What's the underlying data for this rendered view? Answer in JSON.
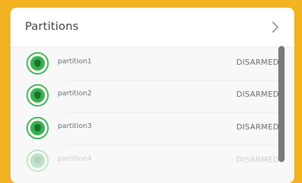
{
  "card": {
    "title": "Partitions",
    "header_icon": "chevron-right-icon"
  },
  "partitions": [
    {
      "name": "partition1",
      "status": "DISARMED",
      "icon": "shield-icon"
    },
    {
      "name": "partition2",
      "status": "DISARMED",
      "icon": "shield-icon"
    },
    {
      "name": "partition3",
      "status": "DISARMED",
      "icon": "shield-icon"
    },
    {
      "name": "partition4",
      "status": "DISARMED",
      "icon": "shield-icon"
    }
  ],
  "colors": {
    "frame": "#f4b323",
    "badge_ring": "#37b24d",
    "badge_fill": "#37b24d",
    "text": "#6a6a6a",
    "scrollbar": "#7a7a7a"
  }
}
